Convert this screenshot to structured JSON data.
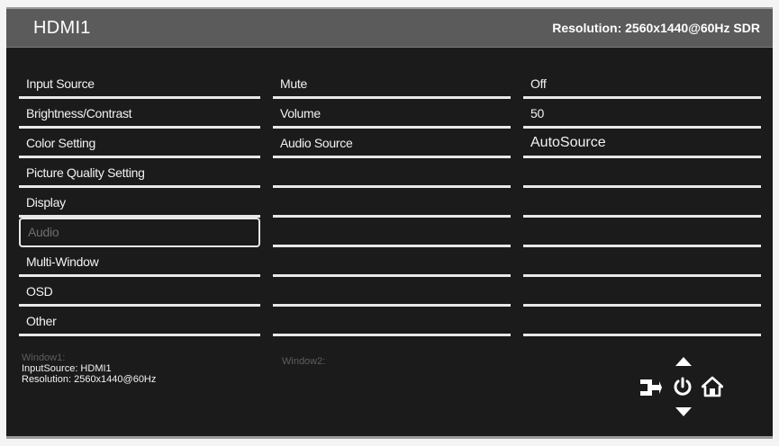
{
  "header": {
    "title": "HDMI1",
    "resolution": "Resolution: 2560x1440@60Hz SDR"
  },
  "menu": {
    "items": [
      {
        "label": "Input Source"
      },
      {
        "label": "Brightness/Contrast"
      },
      {
        "label": "Color Setting"
      },
      {
        "label": "Picture Quality Setting"
      },
      {
        "label": "Display"
      },
      {
        "label": "Audio"
      },
      {
        "label": "Multi-Window"
      },
      {
        "label": "OSD"
      },
      {
        "label": "Other"
      }
    ],
    "selected_index": 5
  },
  "submenu": {
    "items": [
      {
        "label": "Mute"
      },
      {
        "label": "Volume"
      },
      {
        "label": "Audio Source"
      },
      {
        "label": ""
      },
      {
        "label": ""
      },
      {
        "label": ""
      },
      {
        "label": ""
      },
      {
        "label": ""
      },
      {
        "label": ""
      }
    ]
  },
  "values": {
    "items": [
      {
        "label": "Off"
      },
      {
        "label": "50"
      },
      {
        "label": "AutoSource"
      },
      {
        "label": ""
      },
      {
        "label": ""
      },
      {
        "label": ""
      },
      {
        "label": ""
      },
      {
        "label": ""
      },
      {
        "label": ""
      }
    ]
  },
  "window1": {
    "label": "Window1:",
    "input_source": "InputSource: HDMI1",
    "resolution": "Resolution: 2560x1440@60Hz"
  },
  "window2": {
    "label": "Window2:"
  },
  "nav_icons": [
    "arrow-up-icon",
    "enter-icon",
    "power-icon",
    "home-icon",
    "arrow-down-icon"
  ],
  "colors": {
    "background": "#1b1b1b",
    "header": "#5b5b5b",
    "text": "#f2f2f2",
    "disabled_text": "#6e6e6e",
    "divider": "#e8e8e8"
  }
}
